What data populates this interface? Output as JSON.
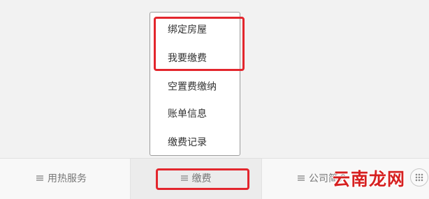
{
  "popup_menu": {
    "items": [
      {
        "label": "绑定房屋",
        "highlighted": true
      },
      {
        "label": "我要缴费",
        "highlighted": true
      },
      {
        "label": "空置费缴纳",
        "highlighted": false
      },
      {
        "label": "账单信息",
        "highlighted": false
      },
      {
        "label": "缴费记录",
        "highlighted": false
      }
    ]
  },
  "bottom_tabs": [
    {
      "label": "用热服务",
      "icon": "menu-lines-icon",
      "active": false
    },
    {
      "label": "缴费",
      "icon": "menu-lines-icon",
      "active": true
    },
    {
      "label": "公司简介",
      "icon": "menu-lines-icon",
      "active": false
    }
  ],
  "watermark": {
    "text": "云南龙网"
  },
  "colors": {
    "highlight_box": "#e3262d",
    "watermark": "#d62020",
    "page_background": "#f2f2f2",
    "tab_text": "#777777"
  }
}
